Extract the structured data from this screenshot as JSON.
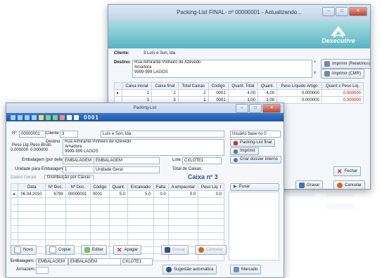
{
  "back_window": {
    "title": "Packing-List FINAL- nº 00000001 - Actualizando...",
    "controls": {
      "minimize": "–",
      "maximize": "□",
      "close": "✕"
    },
    "logo_text": "Dexecutive",
    "client_label": "Cliente:",
    "client_value": "3  Luís e Son, lda",
    "destination_label": "Destino:",
    "destination_lines": [
      "Rua Almirante Pinheiro de Azevedo",
      "Amadora",
      "9999-999 LAGOS"
    ],
    "print_reports_button": "Imprimir (Relatórios)",
    "print_cmr_button": "Imprimir (CMR)",
    "table_headers": [
      "Caixa inicial",
      "Caixa final",
      "Total Caixas",
      "Código",
      "Quant. Total",
      "Quant.",
      "Peso Líquido Artigo",
      "Quant x Peso Liq."
    ],
    "table_rows": [
      [
        "1",
        "2",
        "2",
        "0001",
        "4.00",
        "4.00",
        "0.000000",
        "0.000000"
      ],
      [
        "3",
        "3",
        "1",
        "0001",
        "1.00",
        "1.00",
        "0.000000",
        "0.000000"
      ]
    ],
    "close_button": "Fechar",
    "save_button": "Gravar",
    "cancel_button": "Cancelar"
  },
  "front_window": {
    "title": "Packing-List",
    "controls": {
      "minimize": "–",
      "maximize": "□",
      "close": "✕"
    },
    "toolbar_number": "0001",
    "number_label": "Nº",
    "number_value": "00000001",
    "client_label": "Cliente",
    "client_code": "3",
    "client_name": "Luís e Son, lda",
    "origin_field": "Usuário base no 0",
    "destination_label": "Destino",
    "destination_lines": [
      "Rua Almirante Pinheiro de Azevedo",
      "Amadora",
      "9999-999 LAGOS"
    ],
    "weight_net_label": "Peso Liq.",
    "weight_gross_label": "Peso Bruto",
    "weight_net_value": "0.000000",
    "weight_gross_value": "0.000000",
    "packaging_label": "Embalagem (por defeito)",
    "packaging_value": "EMBALAGEM",
    "packaging_desc": "EMBALAGEM",
    "lot_label": "Lote:",
    "lot_value": "CXLOTE1",
    "unity_label": "Unidade para Embalagem",
    "unity_value": "1",
    "unity_desc": "Unidade Geral",
    "total_boxes_label": "Total de Caixas:",
    "tabs": [
      "Dados Gerais",
      "Distribuição por Caixas"
    ],
    "box_title": "Caixa nº 3",
    "side_buttons": [
      "Packing-List final",
      "Imprimir",
      "Criar dossier interno"
    ],
    "table_headers": [
      "Data",
      "Nº Doc.",
      "Nº Doc.",
      "Código",
      "Quant.",
      "Encaixado",
      "Falta",
      "A empacotar",
      "Peso Liq. t"
    ],
    "table_rows": [
      [
        "06.04.2010",
        "6799",
        "00000001",
        "0001",
        "5.0",
        "5.0",
        "0.0",
        "0.0",
        "0.0"
      ]
    ],
    "push_button": "Puxar",
    "bottom_buttons": {
      "new": "Novo",
      "copy": "Copiar",
      "edit": "Editar",
      "delete": "Apagar",
      "save": "Gravar",
      "cancel": "Cancelar"
    },
    "packaging_bottom_label": "Embalagem:",
    "packaging_bottom_value": "EMBALAGEM",
    "packaging_bottom_desc": "EMBALAGEM",
    "packaging_bottom_lot": "CXLOTE1",
    "storage_label": "Armazém:",
    "auto_suggest_button": "Sugestão automática",
    "marked_button": "Marcado"
  },
  "colors": {
    "accent": "#1d56a8",
    "banner": "#58b4c4",
    "red": "#c00000"
  }
}
